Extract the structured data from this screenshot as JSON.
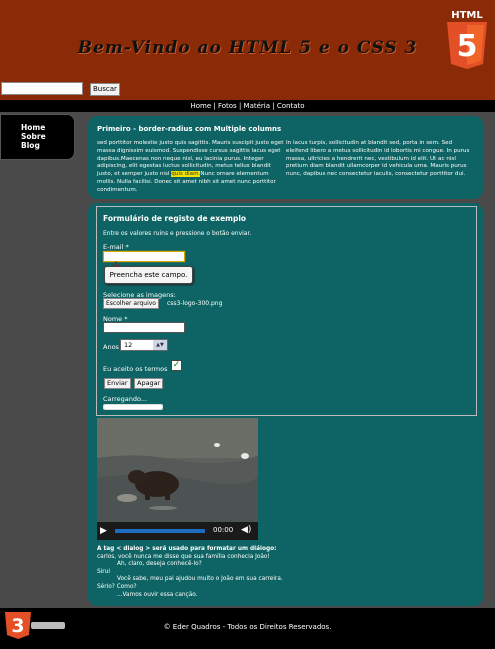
{
  "header": {
    "title": "Bem-Vindo ao HTML 5 e o CSS 3",
    "logo_text": "HTML",
    "logo_number": "5",
    "search_placeholder": "",
    "search_button": "Buscar",
    "background_color": "#8a2a06"
  },
  "nav": {
    "items": [
      "Home",
      "Fotos",
      "Matéria",
      "Contato"
    ],
    "separator": "|"
  },
  "sidebar": {
    "items": [
      "Home",
      "Sobre",
      "Blog"
    ]
  },
  "article": {
    "title": "Primeiro - border-radius com Multiple columns",
    "col1_a": "sed porttitor molestie justo quis sagittis. Mauris suscipit justo eget massa dignissim euismod. Suspendisse cursus sagittis lacus eget dapibus.Maecenas non neque nisl, eu lacinia purus. Integer adipiscing, elit egestas luctus sollicitudin, metus tellus blandit justo, et semper justo nisl",
    "col1_highlight": "quis diam.",
    "col1_b": "Nunc ornare elementum mollis. Nulla facilisi. Donec sit amet nibh sit amet nunc porttitor condimentum.",
    "col2": "In lacus turpis, sollicitudin at blandit sed, porta in sem. Sed eleifend libero a metus sollicitudin id lobortis mi congue. In purus massa, ultricies a hendrerit nec, vestibulum id elit. Ut ac nisl pretium diam blandit ullamcorper id vehicula urna. Mauris purus nunc, dapibus nec consectetur iaculis, consectetur porttitor dui.",
    "highlight_color": "#f2e200",
    "panel_color": "#0e6464"
  },
  "form": {
    "title": "Formulário de registo de exemplo",
    "instructions": "Entre os valores ruins e pressione o botão enviar.",
    "email_label": "E-mail *",
    "email_value": "",
    "tooltip": "Preencha este campo.",
    "images_label": "Selecione as imagens:",
    "file_button": "Escolher arquivo",
    "file_name": "css3-logo-300.png",
    "name_label": "Nome *",
    "name_value": "",
    "age_label": "Anos",
    "age_value": "12",
    "terms_label": "Eu aceito os termos",
    "terms_checked": true,
    "submit_button": "Enviar",
    "clear_button": "Apagar",
    "loading_label": "Carregando...",
    "progress": 1.0
  },
  "video": {
    "time": "00:00",
    "play_icon": "play-icon",
    "volume_icon": "volume-icon"
  },
  "dialog": {
    "intro": "A tag < dialog > será usado para formatar um diálogo:",
    "lines": [
      {
        "text": "carlos, você nunca me disse que sua família conhecia João!",
        "indent": false
      },
      {
        "text": "Ah, claro, deseja conhecê-lo?",
        "indent": true
      },
      {
        "text": "Sirui",
        "indent": false
      },
      {
        "text": "Você sabe, meu pai ajudou muito o João em sua carreira.",
        "indent": true
      },
      {
        "text": "Sério? Como?",
        "indent": false
      },
      {
        "text": "...Vamos ouvir essa canção.",
        "indent": true
      }
    ]
  },
  "footer": {
    "text": "© Eder Quadros - Todos os Direitos Reservados.",
    "logo_number": "3"
  }
}
